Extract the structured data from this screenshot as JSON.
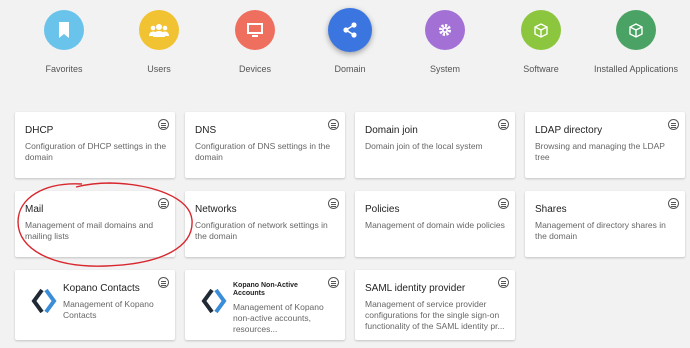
{
  "categories": [
    {
      "label": "Favorites",
      "color": "#6ac3ea",
      "icon": "bookmark-icon"
    },
    {
      "label": "Users",
      "color": "#f1c232",
      "icon": "users-icon"
    },
    {
      "label": "Devices",
      "color": "#ee6f5e",
      "icon": "monitor-icon"
    },
    {
      "label": "Domain",
      "color": "#3a75e0",
      "icon": "share-icon"
    },
    {
      "label": "System",
      "color": "#a371d6",
      "icon": "gear-icon"
    },
    {
      "label": "Software",
      "color": "#8cc63e",
      "icon": "cube-icon"
    },
    {
      "label": "Installed Applications",
      "color": "#4aa364",
      "icon": "cube-icon"
    }
  ],
  "active_category": "Domain",
  "modules": [
    {
      "title": "DHCP",
      "desc": "Configuration of DHCP settings in the domain"
    },
    {
      "title": "DNS",
      "desc": "Configuration of DNS settings in the domain"
    },
    {
      "title": "Domain join",
      "desc": "Domain join of the local system"
    },
    {
      "title": "LDAP directory",
      "desc": "Browsing and managing the LDAP tree"
    },
    {
      "title": "Mail",
      "desc": "Management of mail domains and mailing lists"
    },
    {
      "title": "Networks",
      "desc": "Configuration of network settings in the domain"
    },
    {
      "title": "Policies",
      "desc": "Management of domain wide policies"
    },
    {
      "title": "Shares",
      "desc": "Management of directory shares in the domain"
    },
    {
      "title": "Kopano Contacts",
      "desc": "Management of Kopano Contacts",
      "icon": "kopano-logo-icon"
    },
    {
      "title": "Kopano Non-Active Accounts",
      "desc": "Management of Kopano non-active accounts, resources...",
      "icon": "kopano-logo-icon"
    },
    {
      "title": "SAML identity provider",
      "desc": "Management of service provider configurations for the single sign-on functionality of the SAML identity pr..."
    }
  ],
  "annotation_color": "#d8282e"
}
